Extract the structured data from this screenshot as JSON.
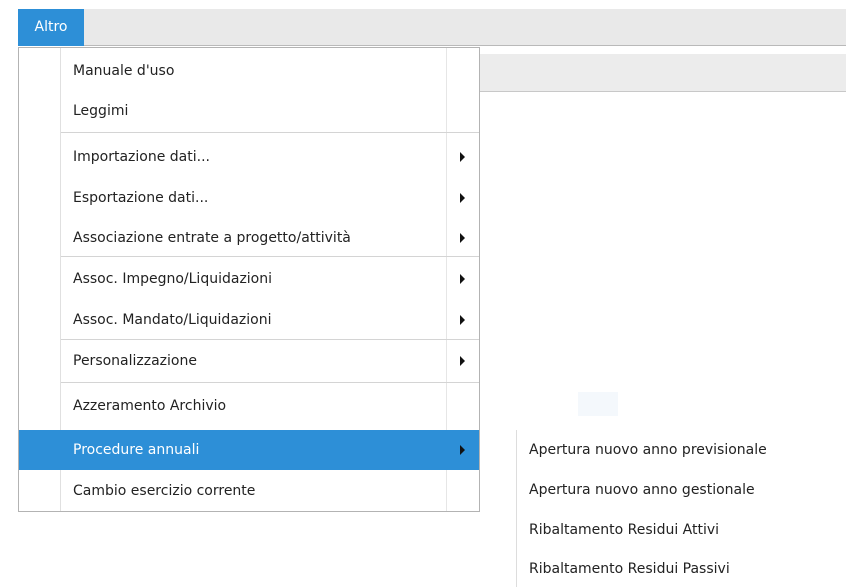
{
  "menubar": {
    "altro_label": "Altro"
  },
  "main_menu": {
    "items": [
      {
        "label": "Manuale d'uso"
      },
      {
        "label": "Leggimi"
      },
      {
        "label": "Importazione dati..."
      },
      {
        "label": "Esportazione dati..."
      },
      {
        "label": "Associazione entrate a progetto/attività"
      },
      {
        "label": "Assoc. Impegno/Liquidazioni"
      },
      {
        "label": "Assoc. Mandato/Liquidazioni"
      },
      {
        "label": "Personalizzazione"
      },
      {
        "label": "Azzeramento Archivio"
      },
      {
        "label": "Procedure annuali"
      },
      {
        "label": "Cambio esercizio corrente"
      }
    ]
  },
  "sub_menu": {
    "items": [
      {
        "label": "Apertura nuovo anno previsionale"
      },
      {
        "label": "Apertura nuovo anno gestionale"
      },
      {
        "label": "Ribaltamento Residui Attivi"
      },
      {
        "label": "Ribaltamento Residui Passivi"
      }
    ]
  },
  "colors": {
    "accent": "#2d8fd7",
    "menubar_bg": "#e9e9e9"
  }
}
